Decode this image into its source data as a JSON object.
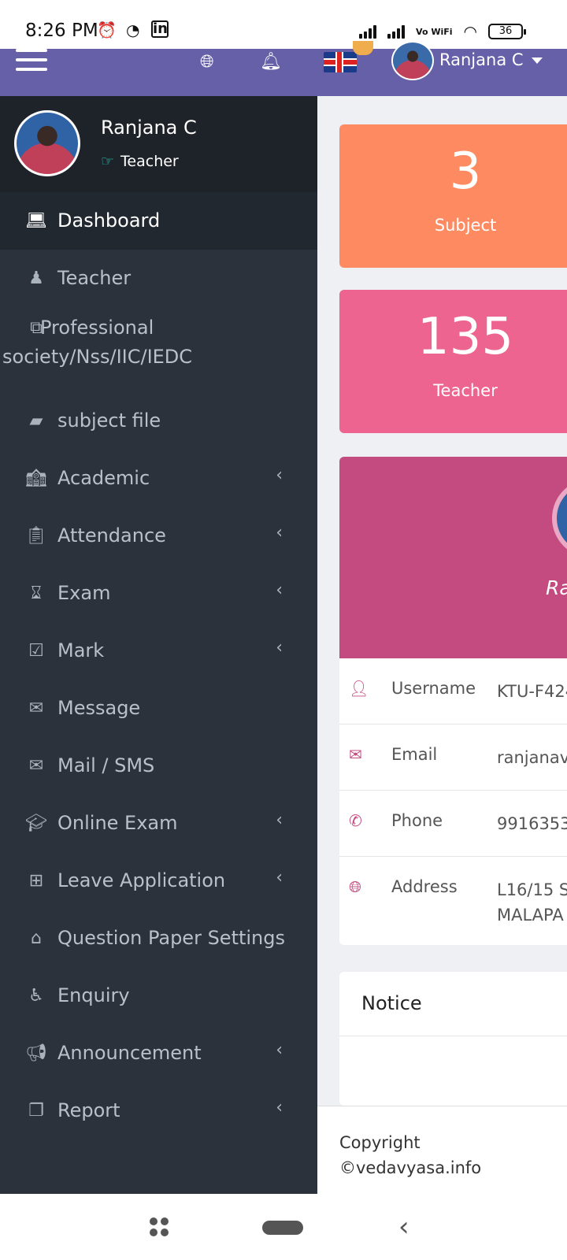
{
  "status_bar": {
    "time": "8:26 PM",
    "icons": [
      "alarm-icon",
      "messenger-icon",
      "linkedin-icon",
      "signal-icon",
      "wifi-icon"
    ],
    "vowifi": "Vo WiFi",
    "battery": "36"
  },
  "header": {
    "user_name": "Ranjana C",
    "icons": [
      "menu-icon",
      "globe-icon",
      "bell-icon",
      "uk-flag-icon"
    ],
    "bg_color": "#6560a8"
  },
  "sidebar": {
    "profile": {
      "name": "Ranjana C",
      "role": "Teacher"
    },
    "items": [
      {
        "label": "Dashboard",
        "icon": "laptop-icon",
        "active": true,
        "submenu": false
      },
      {
        "label": "Teacher",
        "icon": "teacher-icon",
        "submenu": false
      },
      {
        "label": "Professional society/Nss/IIC/IEDC",
        "icon": "object-group-icon",
        "submenu": false
      },
      {
        "label": "subject file",
        "icon": "file-icon",
        "submenu": false
      },
      {
        "label": "Academic",
        "icon": "school-icon",
        "submenu": true
      },
      {
        "label": "Attendance",
        "icon": "clipboard-icon",
        "submenu": true
      },
      {
        "label": "Exam",
        "icon": "hourglass-icon",
        "submenu": true
      },
      {
        "label": "Mark",
        "icon": "checklist-icon",
        "submenu": true
      },
      {
        "label": "Message",
        "icon": "envelope-icon",
        "submenu": false
      },
      {
        "label": "Mail / SMS",
        "icon": "envelope-open-icon",
        "submenu": false
      },
      {
        "label": "Online Exam",
        "icon": "graduation-cap-icon",
        "submenu": true
      },
      {
        "label": "Leave Application",
        "icon": "layout-icon",
        "submenu": true
      },
      {
        "label": "Question Paper Settings",
        "icon": "home-icon",
        "submenu": false
      },
      {
        "label": "Enquiry",
        "icon": "wheelchair-icon",
        "submenu": false
      },
      {
        "label": "Announcement",
        "icon": "bullhorn-icon",
        "submenu": true
      },
      {
        "label": "Report",
        "icon": "copy-icon",
        "submenu": true
      }
    ]
  },
  "dashboard": {
    "cards": [
      {
        "value": "3",
        "label": "Subject",
        "color": "#fd8a60"
      },
      {
        "value": "135",
        "label": "Teacher",
        "color": "#ee6491"
      }
    ],
    "profile_card": {
      "name_partial": "Ra",
      "color": "#c44b80"
    },
    "info": [
      {
        "key": "Username",
        "value": "KTU-F424",
        "icon": "user-icon"
      },
      {
        "key": "Email",
        "value": "ranjanav",
        "icon": "envelope-icon"
      },
      {
        "key": "Phone",
        "value": "9916353",
        "icon": "phone-icon"
      },
      {
        "key": "Address",
        "value_line1": "L16/15 S",
        "value_line2": "MALAPA",
        "icon": "globe-icon"
      }
    ],
    "notice_title": "Notice",
    "footer": {
      "line1": "Copyright",
      "line2": "©vedavyasa.info"
    }
  }
}
